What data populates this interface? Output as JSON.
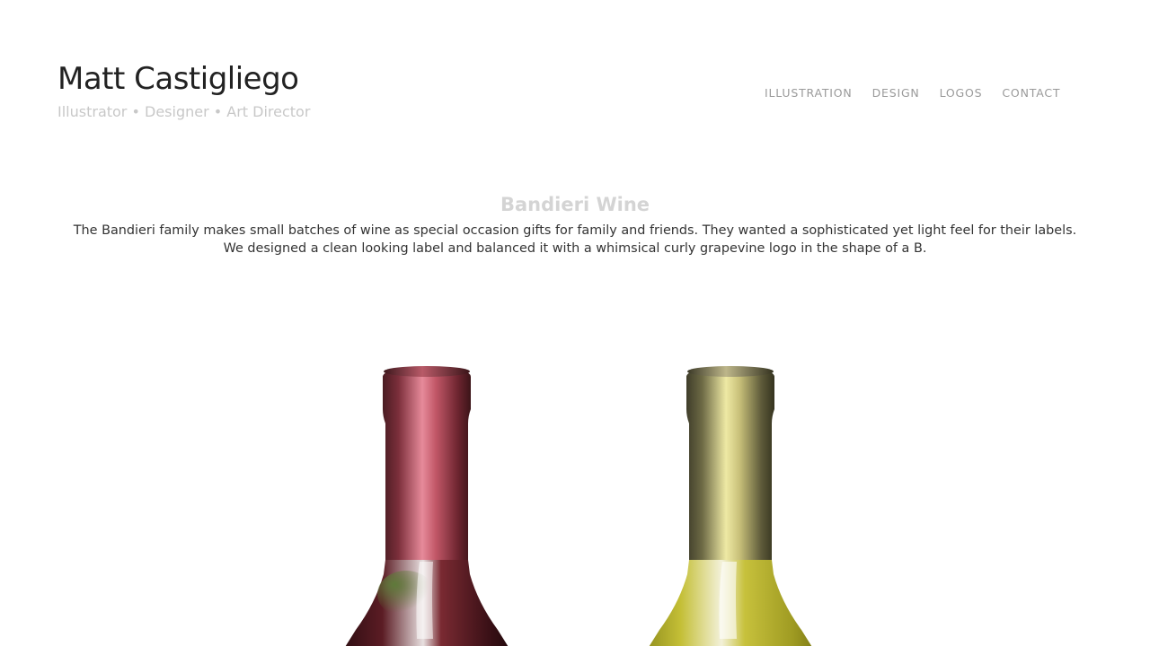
{
  "header": {
    "site_title": "Matt Castigliego",
    "tagline": "Illustrator • Designer • Art Director",
    "nav": [
      {
        "label": "ILLUSTRATION"
      },
      {
        "label": "DESIGN"
      },
      {
        "label": "LOGOS"
      },
      {
        "label": "CONTACT"
      }
    ]
  },
  "project": {
    "title": "Bandieri Wine",
    "description": "The Bandieri family makes small batches of wine as special occasion gifts for family and friends. They wanted a sophisticated yet light feel for their labels. We designed a clean looking label and balanced it with a whimsical curly grapevine logo in the shape of a B."
  },
  "gallery": {
    "images": [
      {
        "name": "red-wine-bottle",
        "capsule_color": "#b8505e",
        "glass_color": "#5a1a22"
      },
      {
        "name": "white-wine-bottle",
        "capsule_color": "#b8ad6a",
        "glass_color": "#c9c23a"
      }
    ]
  }
}
